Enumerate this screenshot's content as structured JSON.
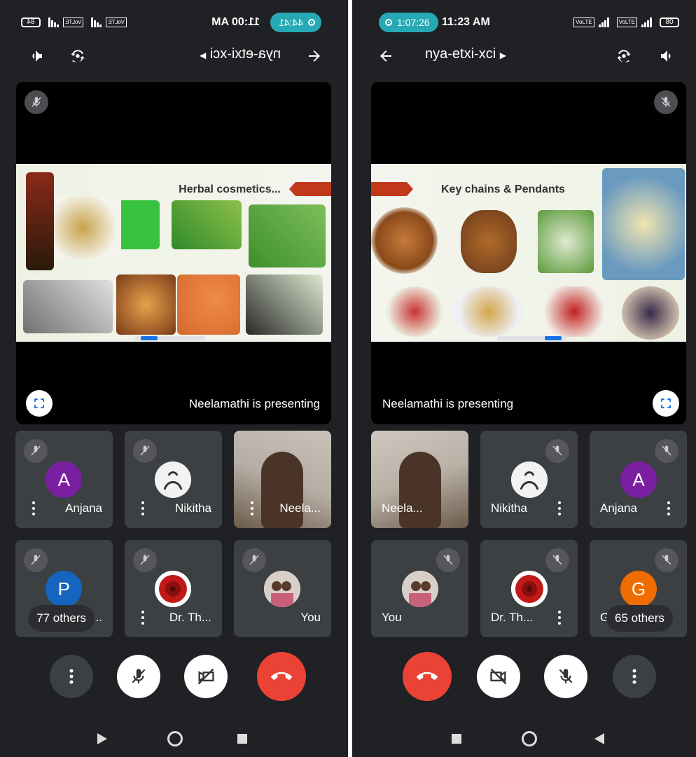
{
  "left": {
    "pill_time": "44:41",
    "clock": "11:00 AM",
    "battery": "84",
    "meeting_title": "nya-etxi-xci",
    "slide_title": "Herbal cosmetics...",
    "presenter_label": "Neelamathi is presenting",
    "tiles": [
      {
        "name": "Neela...",
        "initial": "",
        "color": "#7b1fa2"
      },
      {
        "name": "Nikitha",
        "initial": "",
        "color": "#ddd"
      },
      {
        "name": "Anjana",
        "initial": "A",
        "color": "#7b1fa2"
      },
      {
        "name": "You",
        "initial": "",
        "color": "#ddd"
      },
      {
        "name": "Dr. Th...",
        "initial": "",
        "color": "#ddd"
      },
      {
        "name": "Pa...",
        "initial": "P",
        "color": "#1565c0"
      }
    ],
    "others": "77 others"
  },
  "right": {
    "pill_time": "1:07:26",
    "clock": "11:23 AM",
    "battery": "80",
    "meeting_title": "nya-etxi-xci",
    "slide_title": "Key chains & Pendants",
    "presenter_label": "Neelamathi is presenting",
    "tiles": [
      {
        "name": "Neela...",
        "initial": "",
        "color": "#ddd"
      },
      {
        "name": "Nikitha",
        "initial": "",
        "color": "#ddd"
      },
      {
        "name": "Anjana",
        "initial": "A",
        "color": "#7b1fa2"
      },
      {
        "name": "You",
        "initial": "",
        "color": "#ddd"
      },
      {
        "name": "Dr. Th...",
        "initial": "",
        "color": "#ddd"
      },
      {
        "name": "G...",
        "initial": "G",
        "color": "#ef6c00"
      }
    ],
    "others": "65 others"
  },
  "colors": {
    "background": "#202124",
    "tile": "#3c4043",
    "end_call": "#ea4335",
    "recording_pill": "#26a9b5",
    "accent_blue": "#1a73e8"
  },
  "icons": {
    "camera_off": "video-off-icon",
    "mic_off": "mic-off-icon",
    "end_call": "phone-hangup-icon",
    "more": "more-vert-icon",
    "flip_camera": "camera-flip-icon",
    "speaker": "speaker-icon",
    "back": "arrow-left-icon",
    "fullscreen": "fullscreen-icon"
  }
}
